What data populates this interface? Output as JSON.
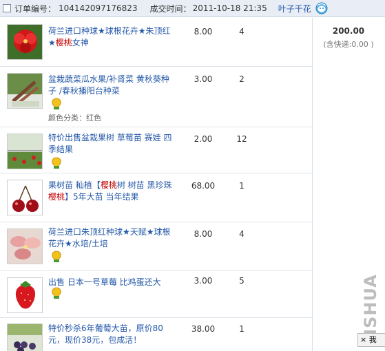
{
  "order": {
    "order_no_label": "订单编号：",
    "order_no": "104142097176823",
    "time_label": "成交时间：",
    "time": "2011-10-18 21:35",
    "seller": "叶子千花"
  },
  "summary": {
    "total": "200.00",
    "shipping": "(含快递:0.00 )"
  },
  "items": [
    {
      "title_a": "荷兰进口种球★球根花卉★朱顶红★",
      "title_hl": "樱桃",
      "title_b": "女神",
      "price": "8.00",
      "qty": "4"
    },
    {
      "title_a": "盆栽蔬菜瓜水果/补肾菜 黄秋葵种子 /春秋播阳台种菜",
      "title_hl": "",
      "title_b": "",
      "meta": "颜色分类：红色",
      "price": "3.00",
      "qty": "2"
    },
    {
      "title_a": "特价出售盆栽果树 草莓苗 赛娃 四季结果",
      "title_hl": "",
      "title_b": "",
      "price": "2.00",
      "qty": "12"
    },
    {
      "title_a": "果树苗 籼植【",
      "title_hl": "樱桃",
      "title_b": "树 树苗 黑珍珠",
      "title_hl2": "樱桃",
      "title_c": "】5年大苗 当年结果",
      "price": "68.00",
      "qty": "1"
    },
    {
      "title_a": "荷兰进口朱顶红种球★天赋★球根花卉★水培/土培",
      "title_hl": "",
      "title_b": "",
      "price": "8.00",
      "qty": "4"
    },
    {
      "title_a": "出售 日本一号草莓 比鸡蛋还大",
      "title_hl": "",
      "title_b": "",
      "price": "3.00",
      "qty": "5"
    },
    {
      "title_a": "特价秒杀6年葡萄大苗，原价80元，现价38元，包成活！",
      "title_hl": "",
      "title_b": "",
      "price": "38.00",
      "qty": "1"
    }
  ],
  "watermark": "MSHUA",
  "chat_tab": "我",
  "chat_tab_close": "×"
}
